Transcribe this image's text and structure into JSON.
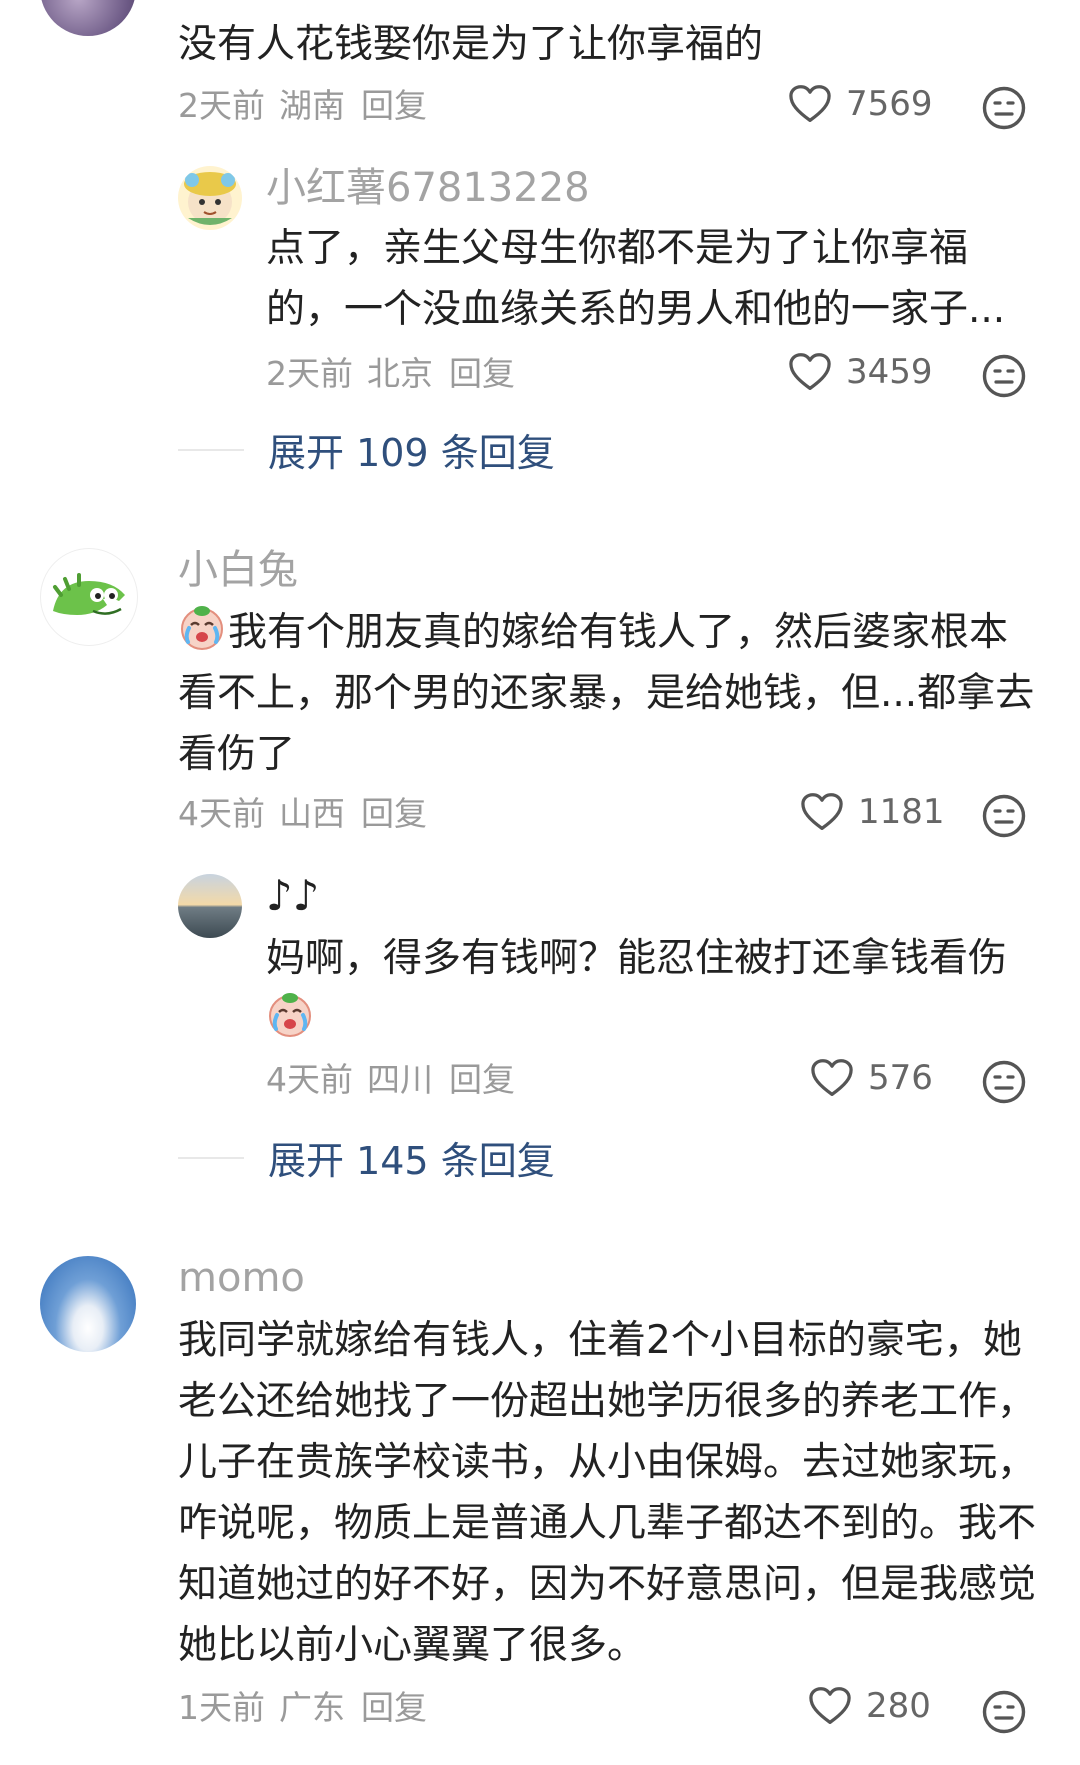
{
  "comments": [
    {
      "text": "没有人花钱娶你是为了让你享福的",
      "time": "2天前",
      "region": "湖南",
      "reply_label": "回复",
      "likes": "7569",
      "replies": [
        {
          "username": "小红薯67813228",
          "text": "点了，亲生父母生你都不是为了让你享福的，一个没血缘关系的男人和他的一家子...",
          "time": "2天前",
          "region": "北京",
          "reply_label": "回复",
          "likes": "3459"
        }
      ],
      "expand_label": "展开 109 条回复"
    },
    {
      "username": "小白兔",
      "text": "我有个朋友真的嫁给有钱人了，然后婆家根本看不上，那个男的还家暴，是给她钱，但...都拿去看伤了",
      "time": "4天前",
      "region": "山西",
      "reply_label": "回复",
      "likes": "1181",
      "replies": [
        {
          "username": "♪♪",
          "text": "妈啊，得多有钱啊？能忍住被打还拿钱看伤",
          "time": "4天前",
          "region": "四川",
          "reply_label": "回复",
          "likes": "576"
        }
      ],
      "expand_label": "展开 145 条回复"
    },
    {
      "username": "momo",
      "text": "我同学就嫁给有钱人，住着2个小目标的豪宅，她老公还给她找了一份超出她学历很多的养老工作，儿子在贵族学校读书，从小由保姆。去过她家玩，咋说呢，物质上是普通人几辈子都达不到的。我不知道她过的好不好，因为不好意思问，但是我感觉她比以前小心翼翼了很多。",
      "time": "1天前",
      "region": "广东",
      "reply_label": "回复",
      "likes": "280"
    }
  ],
  "icons": {
    "like": "heart-outline-icon",
    "emoji": "neutral-face-icon",
    "crying_emoji": "crying-face-emoji"
  },
  "colors": {
    "username": "#a3a3a3",
    "text": "#222222",
    "meta": "#9a9a9a",
    "expand_link": "#2f4f7c"
  }
}
